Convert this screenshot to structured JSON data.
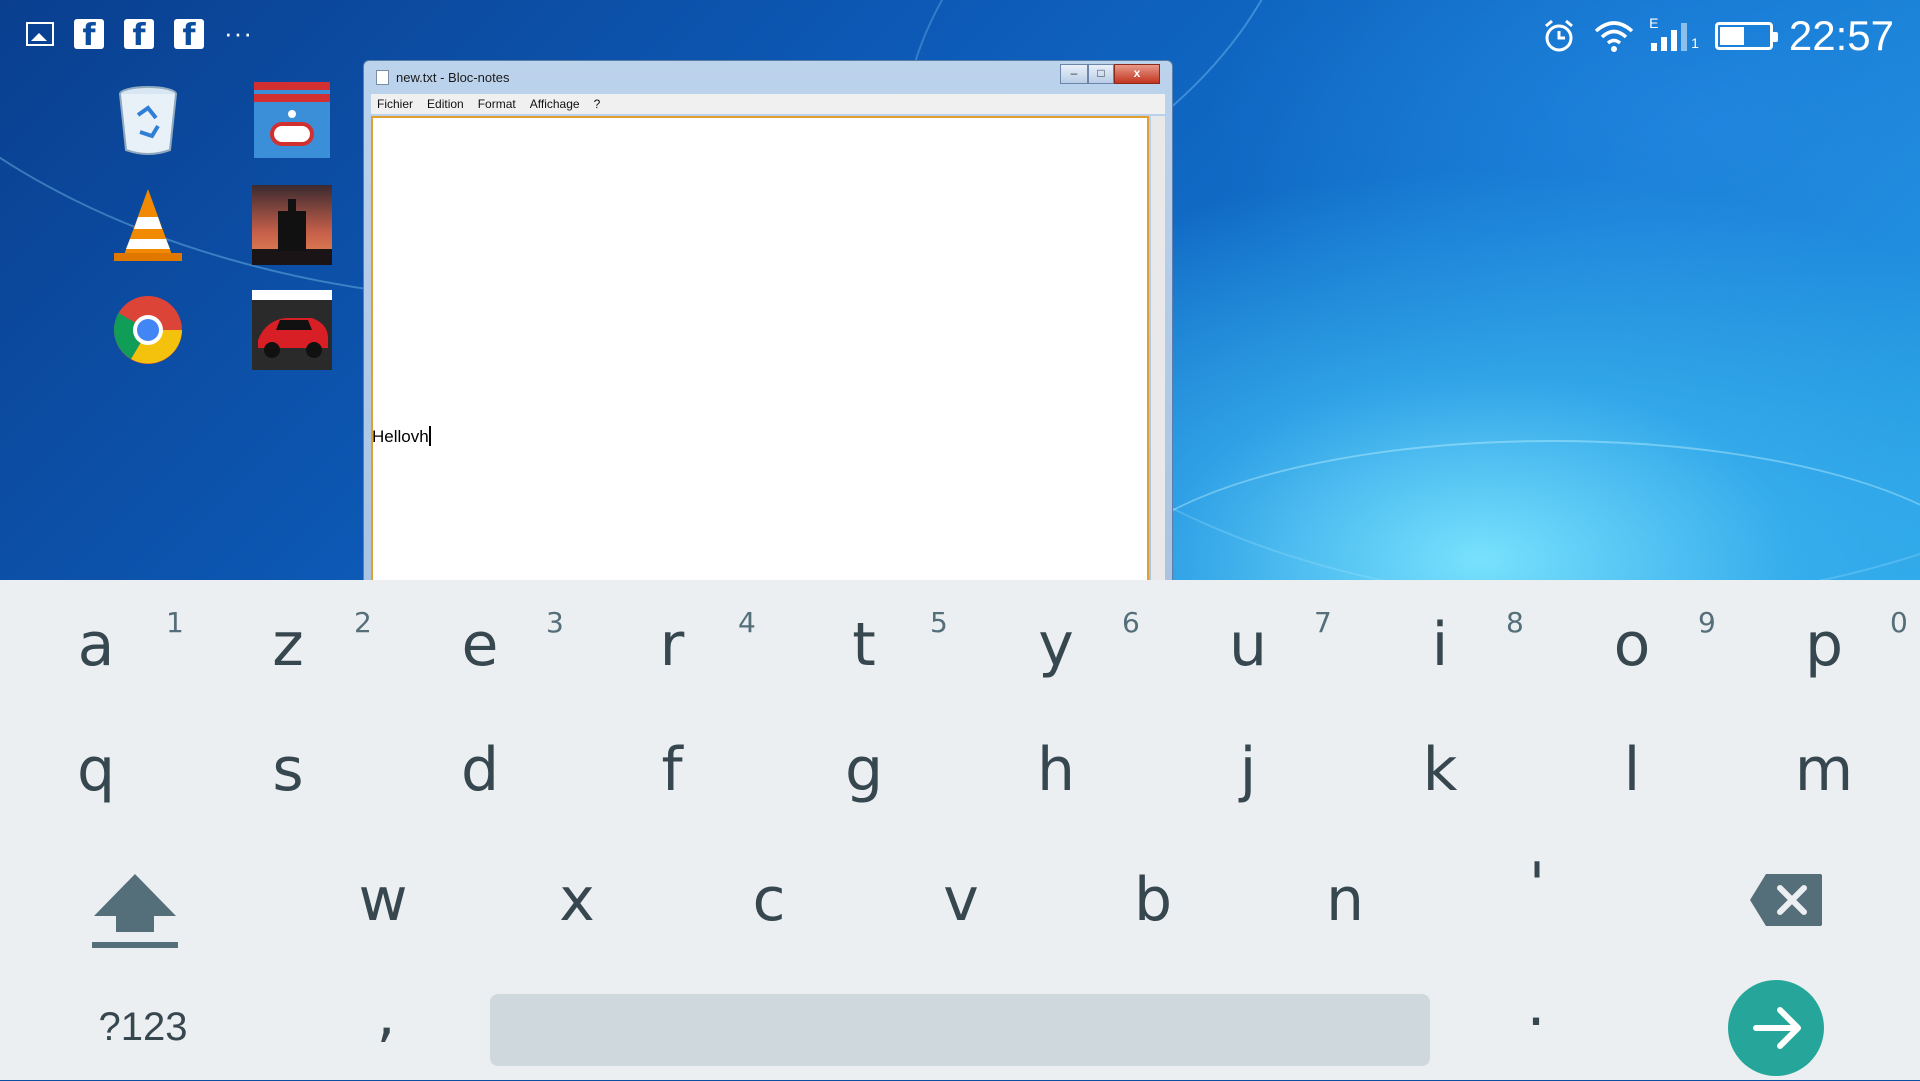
{
  "status_bar": {
    "time": "22:57",
    "network_type": "E",
    "sim_slot": "1",
    "overflow": "···",
    "notification_icons": [
      "gallery-icon",
      "facebook-icon",
      "facebook-icon",
      "facebook-icon"
    ],
    "fb_letter": "f"
  },
  "desktop": {
    "icons": [
      "recycle-bin-icon",
      "winrar-icon",
      "vlc-icon",
      "game-silhouette-icon",
      "chrome-icon",
      "race-car-game-icon"
    ]
  },
  "notepad": {
    "title": "new.txt - Bloc-notes",
    "menu": [
      "Fichier",
      "Edition",
      "Format",
      "Affichage",
      "?"
    ],
    "content": "Hellovh",
    "buttons": {
      "minimize": "–",
      "maximize": "□",
      "close": "x"
    }
  },
  "keyboard": {
    "row1": [
      {
        "key": "a",
        "hint": "1"
      },
      {
        "key": "z",
        "hint": "2"
      },
      {
        "key": "e",
        "hint": "3"
      },
      {
        "key": "r",
        "hint": "4"
      },
      {
        "key": "t",
        "hint": "5"
      },
      {
        "key": "y",
        "hint": "6"
      },
      {
        "key": "u",
        "hint": "7"
      },
      {
        "key": "i",
        "hint": "8"
      },
      {
        "key": "o",
        "hint": "9"
      },
      {
        "key": "p",
        "hint": "0"
      }
    ],
    "row2": [
      "q",
      "s",
      "d",
      "f",
      "g",
      "h",
      "j",
      "k",
      "l",
      "m"
    ],
    "row3": [
      "w",
      "x",
      "c",
      "v",
      "b",
      "n",
      "'"
    ],
    "symbols_label": "?123",
    "comma": ",",
    "period": ".",
    "colors": {
      "background": "#eceff1",
      "key_text": "#37474f",
      "enter": "#26a69a",
      "space": "#cfd8dc"
    }
  }
}
